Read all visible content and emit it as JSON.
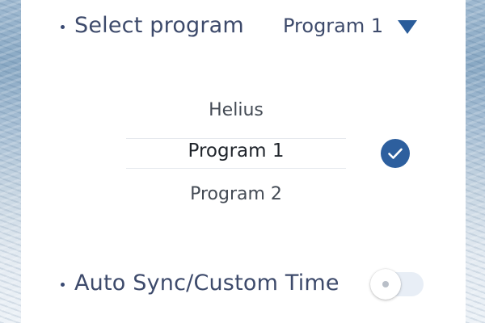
{
  "settings": {
    "select_program": {
      "label": "Select program",
      "value": "Program 1",
      "expanded": true
    },
    "program_picker": {
      "options": [
        "Helius",
        "Program 1",
        "Program 2"
      ],
      "selected": "Program 1"
    },
    "auto_sync": {
      "label": "Auto Sync/Custom Time",
      "enabled": false
    }
  },
  "icons": {
    "dropdown": "caret-down-icon",
    "selected": "check-circle-icon"
  },
  "colors": {
    "accent": "#2d5f9e",
    "label_text": "#3d4a6b",
    "card_background": "#ffffff"
  }
}
